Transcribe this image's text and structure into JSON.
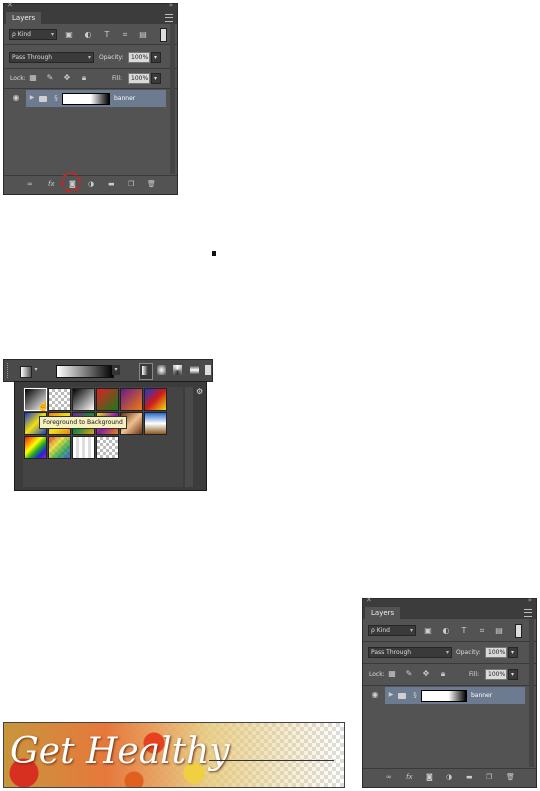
{
  "panel": {
    "tab_label": "Layers",
    "kind_label": "Kind",
    "blend_mode": "Pass Through",
    "opacity_label": "Opacity:",
    "opacity_value": "100%",
    "lock_label": "Lock:",
    "fill_label": "Fill:",
    "fill_value": "100%",
    "layer_name": "banner",
    "fx_label": "fx"
  },
  "gradient_picker": {
    "tooltip": "Foreground to Background"
  },
  "banner": {
    "text": "Get Healthy"
  },
  "colors": {
    "panel_bg": "#535353",
    "selected_layer": "#6d7b90",
    "highlight_ring": "#d62020"
  },
  "icons": [
    "eye-icon",
    "expand-arrow-icon",
    "folder-icon",
    "link-icon",
    "fx-icon",
    "add-mask-icon",
    "adjustment-icon",
    "new-group-icon",
    "new-layer-icon",
    "trash-icon",
    "search-icon",
    "filter-pixel-icon",
    "filter-adjustment-icon",
    "filter-type-icon",
    "filter-shape-icon",
    "filter-smart-object-icon",
    "filter-toggle-icon",
    "lock-transparent-icon",
    "lock-pixels-icon",
    "lock-position-icon",
    "lock-all-icon",
    "gradient-icon",
    "linear-gradient-icon",
    "radial-gradient-icon",
    "angle-gradient-icon",
    "reflected-gradient-icon",
    "diamond-gradient-icon",
    "gear-icon",
    "cursor-icon"
  ]
}
